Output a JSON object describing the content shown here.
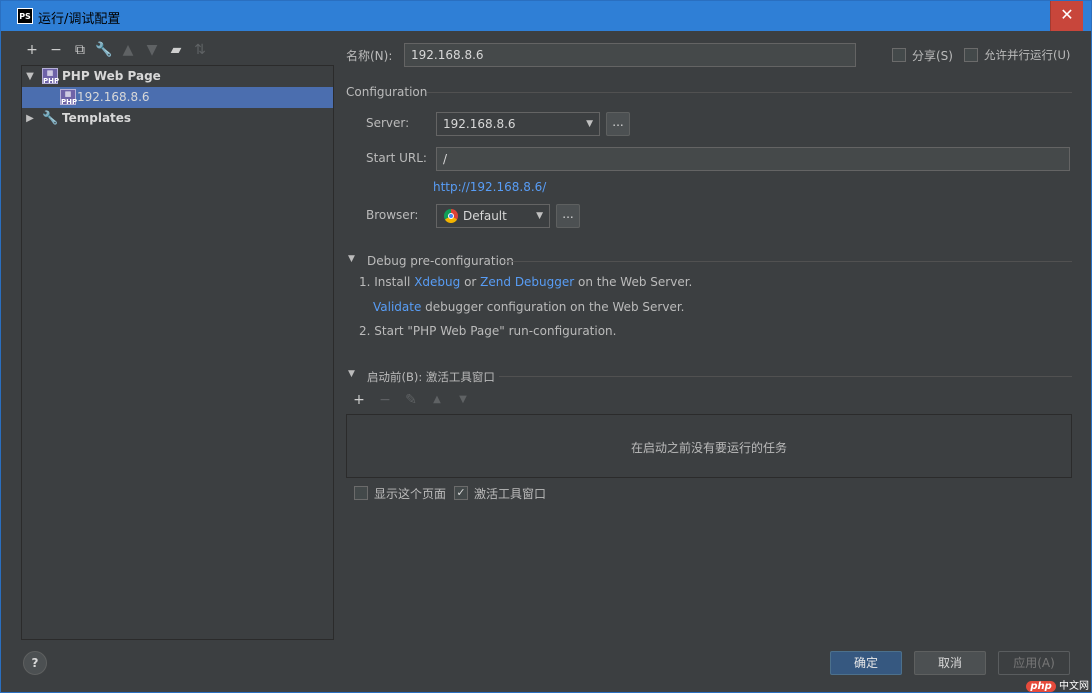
{
  "window": {
    "app_icon": "PS",
    "title": "运行/调试配置",
    "close": "✕"
  },
  "left_toolbar": {
    "icons": [
      "plus-icon",
      "minus-icon",
      "copy-icon",
      "wrench-icon",
      "arrow-up-icon",
      "arrow-down-icon",
      "folder-add-icon",
      "sort-icon"
    ]
  },
  "tree": {
    "group_label": "PHP Web Page",
    "item_label": "192.168.8.6",
    "templates_label": "Templates"
  },
  "form": {
    "name_label": "名称(N):",
    "name_value": "192.168.8.6",
    "share_label": "分享(S)",
    "parallel_label": "允许并行运行(U)",
    "config_section": "Configuration",
    "server_label": "Server:",
    "server_value": "192.168.8.6",
    "server_more": "...",
    "start_url_label": "Start URL:",
    "start_url_value": "/",
    "url_preview": "http://192.168.8.6/",
    "browser_label": "Browser:",
    "browser_value": "Default",
    "browser_more": "..."
  },
  "debug": {
    "section": "Debug pre-configuration",
    "line1_prefix": "1. Install ",
    "xdebug": "Xdebug",
    "or": " or ",
    "zend": "Zend Debugger",
    "line1_suffix": " on the Web Server.",
    "validate": "Validate",
    "line2_suffix": " debugger configuration on the Web Server.",
    "line3": "2. Start \"PHP Web Page\" run-configuration."
  },
  "before_launch": {
    "section": "启动前(B): 激活工具窗口",
    "empty_text": "在启动之前没有要运行的任务",
    "show_page_label": "显示这个页面",
    "activate_label": "激活工具窗口",
    "activate_checked": "✓"
  },
  "buttons": {
    "help": "?",
    "ok": "确定",
    "cancel": "取消",
    "apply": "应用(A)"
  },
  "watermark": {
    "badge": "php",
    "text": "中文网"
  },
  "colors": {
    "titlebar": "#2f7fd6",
    "background": "#3c3f41",
    "selection": "#4b6eaf",
    "link": "#589df6",
    "close": "#c8463b"
  }
}
